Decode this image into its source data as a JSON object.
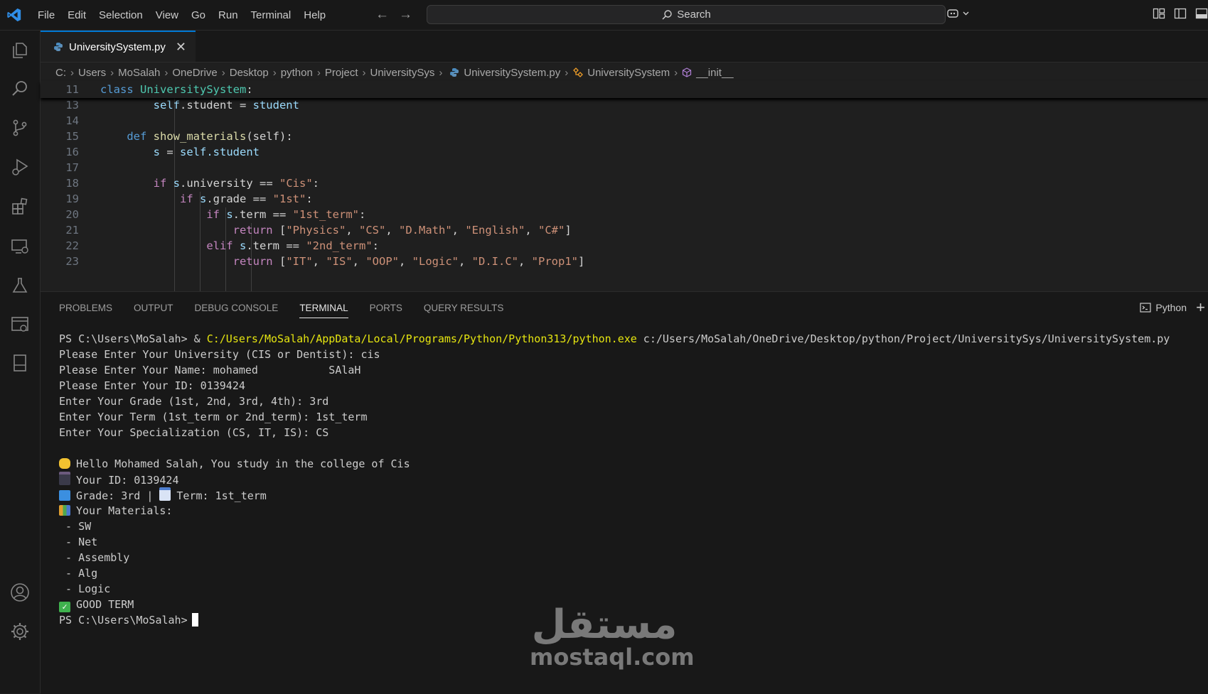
{
  "menu": [
    "File",
    "Edit",
    "Selection",
    "View",
    "Go",
    "Run",
    "Terminal",
    "Help"
  ],
  "search": {
    "label": "Search"
  },
  "tab": {
    "label": "UniversitySystem.py",
    "close": "✕"
  },
  "breadcrumb": [
    "C:",
    "Users",
    "MoSalah",
    "OneDrive",
    "Desktop",
    "python",
    "Project",
    "UniversitySys",
    "UniversitySystem.py",
    "UniversitySystem",
    "__init__"
  ],
  "editor": {
    "sticky_line": {
      "num": "11",
      "kw": "class",
      "name": "UniversitySystem",
      "colon": ":"
    },
    "lines": [
      {
        "num": "13",
        "a": "self",
        "b": ".student = ",
        "c": "student"
      },
      {
        "num": "14"
      },
      {
        "num": "15",
        "kw": "def",
        "fn": "show_materials",
        "args": "(self):"
      },
      {
        "num": "16",
        "a": "s",
        "b": " = ",
        "c": "self",
        "d": ".student"
      },
      {
        "num": "17"
      },
      {
        "num": "18",
        "kw": "if",
        "v": "s",
        "attr": ".university == ",
        "s": "\"Cis\"",
        "end": ":"
      },
      {
        "num": "19",
        "kw": "if",
        "v": "s",
        "attr": ".grade == ",
        "s": "\"1st\"",
        "end": ":"
      },
      {
        "num": "20",
        "kw": "if",
        "v": "s",
        "attr": ".term == ",
        "s": "\"1st_term\"",
        "end": ":"
      },
      {
        "num": "21",
        "kw": "return",
        "items": [
          "\"Physics\"",
          "\"CS\"",
          "\"D.Math\"",
          "\"English\"",
          "\"C#\""
        ]
      },
      {
        "num": "22",
        "kw": "elif",
        "v": "s",
        "attr": ".term == ",
        "s": "\"2nd_term\"",
        "end": ":"
      },
      {
        "num": "23",
        "kw": "return",
        "items": [
          "\"IT\"",
          "\"IS\"",
          "\"OOP\"",
          "\"Logic\"",
          "\"D.I.C\"",
          "\"Prop1\""
        ]
      }
    ]
  },
  "panel": {
    "tabs": [
      "PROBLEMS",
      "OUTPUT",
      "DEBUG CONSOLE",
      "TERMINAL",
      "PORTS",
      "QUERY RESULTS"
    ],
    "active_tab": "TERMINAL",
    "shell_label": "Python"
  },
  "terminal": {
    "prompt": "PS C:\\Users\\MoSalah>",
    "cmd_amp": " & ",
    "cmd_exe": "C:/Users/MoSalah/AppData/Local/Programs/Python/Python313/python.exe",
    "cmd_script": " c:/Users/MoSalah/OneDrive/Desktop/python/Project/UniversitySys/UniversitySystem.py",
    "inputs": [
      "Please Enter Your University (CIS or Dentist): cis",
      "Please Enter Your Name: mohamed           SAlaH",
      "Please Enter Your ID: 0139424",
      "Enter Your Grade (1st, 2nd, 3rd, 4th): 3rd",
      "Enter Your Term (1st_term or 2nd_term): 1st_term",
      "Enter Your Specialization (CS, IT, IS): CS"
    ],
    "hello": "Hello Mohamed Salah, You study in the college of Cis",
    "id_line": "Your ID: 0139424",
    "grade_line": "Grade: 3rd | ",
    "term_line": "Term: 1st_term",
    "materials_title": "Your Materials:",
    "materials": [
      " - SW",
      " - Net",
      " - Assembly",
      " - Alg",
      " - Logic"
    ],
    "result": "GOOD TERM",
    "final_prompt": "PS C:\\Users\\MoSalah>"
  },
  "watermark": {
    "arabic": "مستقل",
    "latin": "mostaql.com"
  },
  "colors": {
    "accent": "#0078d4",
    "path_yellow": "#e5e510"
  }
}
